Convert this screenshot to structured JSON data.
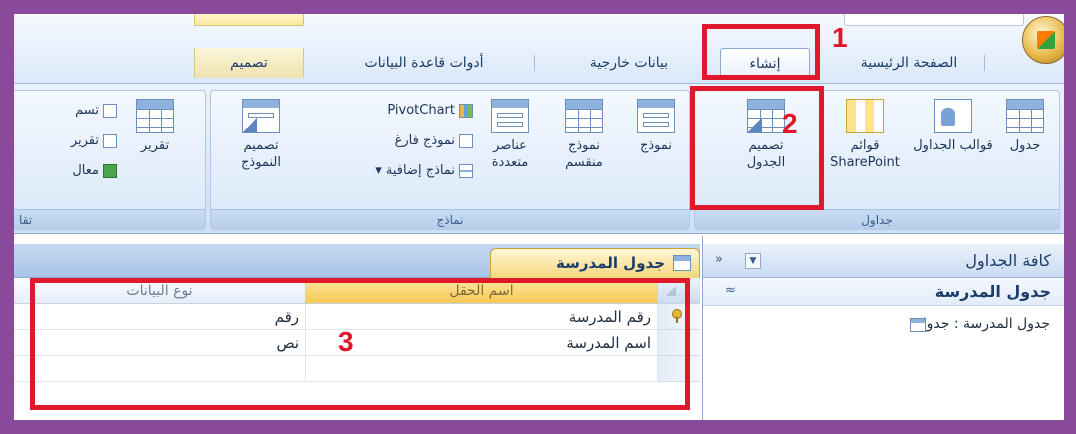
{
  "tabs": [
    "الصفحة الرئيسية",
    "إنشاء",
    "بيانات خارجية",
    "أدوات قاعدة البيانات",
    "تصميم"
  ],
  "ribbon": {
    "groups": {
      "tables": "جداول",
      "forms": "نماذج",
      "reports_partial": "تقا"
    },
    "buttons": {
      "table": "جدول",
      "table_templates": "قوالب الجداول",
      "sharepoint_lists_top": "قوائم",
      "sharepoint_lists_bottom": "SharePoint",
      "table_design_top": "تصميم",
      "table_design_bottom": "الجدول",
      "form": "نموذج",
      "split_form_top": "نموذج",
      "split_form_bottom": "منقسم",
      "multiple_items_top": "عناصر",
      "multiple_items_bottom": "متعددة",
      "pivotchart": "PivotChart",
      "blank_form": "نموذج فارغ",
      "more_forms": "نماذج إضافية",
      "form_design_top": "تصميم",
      "form_design_bottom": "النموذج",
      "report": "تقرير",
      "report_partial_1": "تسم",
      "report_partial_2": "تقرير",
      "report_partial_3": "معال"
    }
  },
  "nav": {
    "title": "كافة الجداول",
    "group_title": "جدول المدرسة",
    "item": "جدول المدرسة : جدول"
  },
  "document": {
    "tab_title": "جدول المدرسة",
    "columns": {
      "field_name": "اسم الحقل",
      "data_type": "نوع البيانات"
    },
    "rows": [
      {
        "field": "رقم المدرسة",
        "type": "رقم",
        "primary_key": true
      },
      {
        "field": "اسم المدرسة",
        "type": "نص",
        "primary_key": false
      }
    ]
  },
  "annotations": {
    "step1": "1",
    "step2": "2",
    "step3": "3"
  },
  "colors": {
    "frame": "#8a4a9c",
    "annotation": "#e0182c",
    "selected_header": "#f6c958"
  }
}
